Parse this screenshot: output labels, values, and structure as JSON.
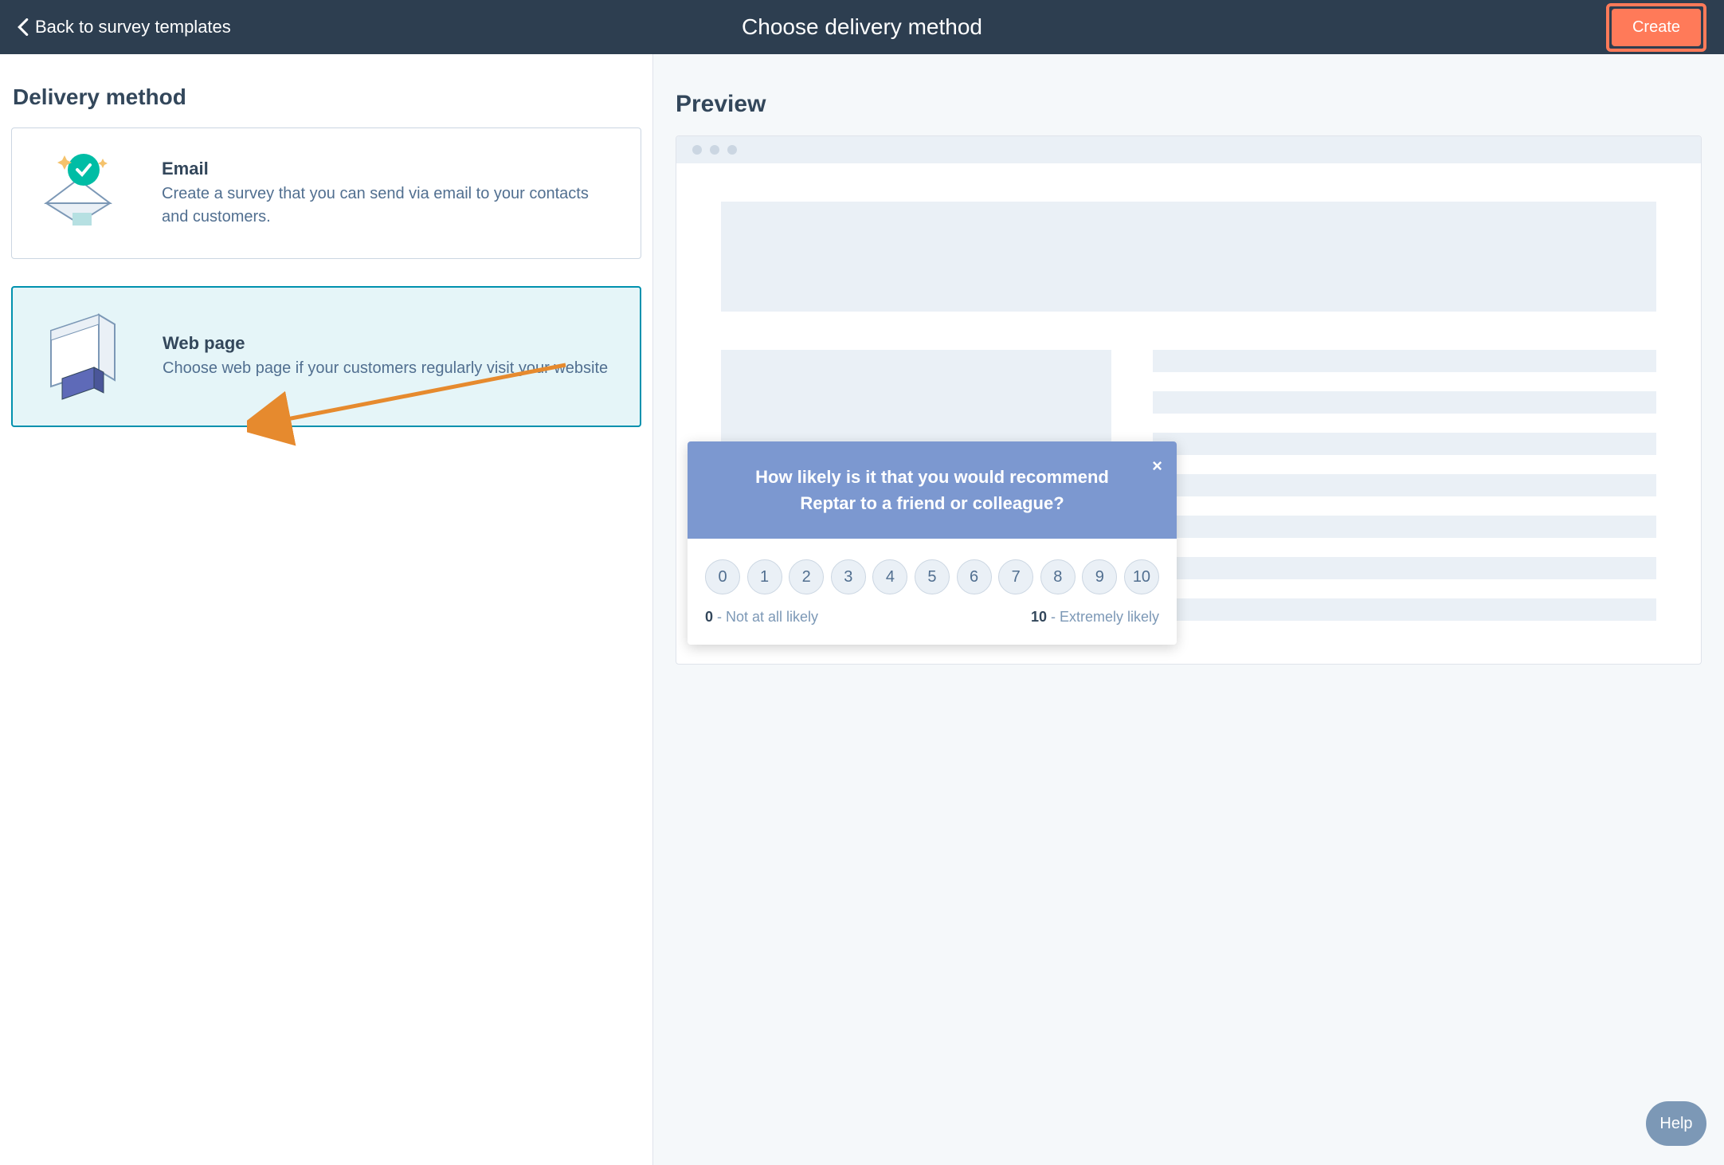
{
  "topbar": {
    "back_label": "Back to survey templates",
    "title": "Choose delivery method",
    "create_label": "Create"
  },
  "left": {
    "heading": "Delivery method",
    "options": [
      {
        "title": "Email",
        "desc": "Create a survey that you can send via email to your contacts and customers."
      },
      {
        "title": "Web page",
        "desc": "Choose web page if your customers regularly visit your website"
      }
    ]
  },
  "preview": {
    "heading": "Preview",
    "survey": {
      "question": "How likely is it that you would recommend Reptar to a friend or colleague?",
      "close": "×",
      "ratings": [
        "0",
        "1",
        "2",
        "3",
        "4",
        "5",
        "6",
        "7",
        "8",
        "9",
        "10"
      ],
      "low_value": "0",
      "low_label": " - Not at all likely",
      "high_value": "10",
      "high_label": " - Extremely likely"
    }
  },
  "help": {
    "label": "Help"
  },
  "colors": {
    "accent": "#ff7a59",
    "header": "#2d3e50",
    "selected": "#0091ae",
    "surveyHead": "#7c98d0"
  }
}
